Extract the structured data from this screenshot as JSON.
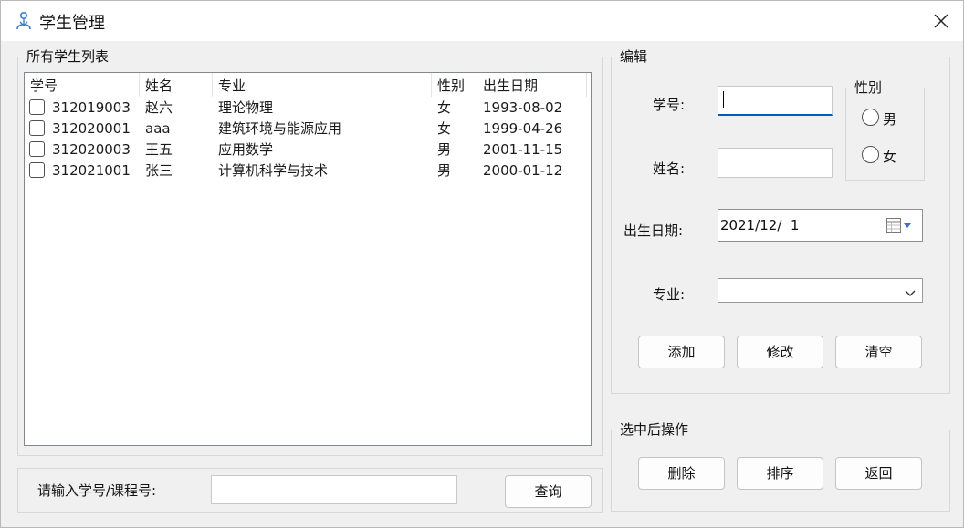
{
  "window": {
    "title": "学生管理"
  },
  "list_group": {
    "title": "所有学生列表",
    "columns": [
      "学号",
      "姓名",
      "专业",
      "性别",
      "出生日期"
    ],
    "rows": [
      {
        "id": "312019003",
        "name": "赵六",
        "major": "理论物理",
        "gender": "女",
        "birth": "1993-08-02"
      },
      {
        "id": "312020001",
        "name": "aaa",
        "major": "建筑环境与能源应用",
        "gender": "女",
        "birth": "1999-04-26"
      },
      {
        "id": "312020003",
        "name": "王五",
        "major": "应用数学",
        "gender": "男",
        "birth": "2001-11-15"
      },
      {
        "id": "312021001",
        "name": "张三",
        "major": "计算机科学与技术",
        "gender": "男",
        "birth": "2000-01-12"
      }
    ]
  },
  "search": {
    "label": "请输入学号/课程号:",
    "value": "",
    "button": "查询"
  },
  "edit_group": {
    "title": "编辑",
    "id_label": "学号:",
    "id_value": "",
    "name_label": "姓名:",
    "name_value": "",
    "gender_group": {
      "title": "性别",
      "male": "男",
      "female": "女"
    },
    "birth_label": "出生日期:",
    "birth_value": "2021/12/  1",
    "major_label": "专业:",
    "major_value": "",
    "buttons": {
      "add": "添加",
      "modify": "修改",
      "clear": "清空"
    }
  },
  "selected_group": {
    "title": "选中后操作",
    "buttons": {
      "delete": "删除",
      "sort": "排序",
      "back": "返回"
    }
  }
}
